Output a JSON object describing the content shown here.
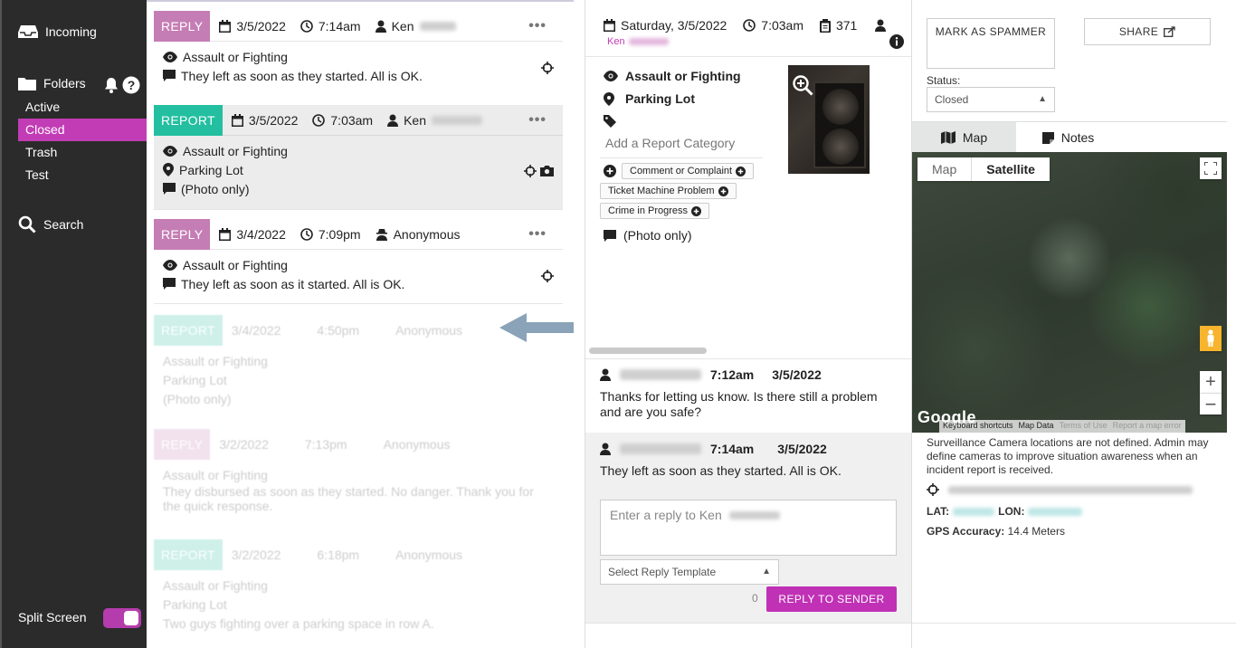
{
  "sidebar": {
    "incoming": "Incoming",
    "folders": "Folders",
    "items": [
      {
        "label": "Active"
      },
      {
        "label": "Closed"
      },
      {
        "label": "Trash"
      },
      {
        "label": "Test"
      }
    ],
    "search": "Search",
    "split_screen": "Split Screen"
  },
  "list": {
    "cards": [
      {
        "type": "REPLY",
        "date": "3/5/2022",
        "time": "7:14am",
        "sender": "Ken",
        "category": "Assault or Fighting",
        "message": "They left as soon as they started. All is OK."
      },
      {
        "type": "REPORT",
        "date": "3/5/2022",
        "time": "7:03am",
        "sender": "Ken",
        "category": "Assault or Fighting",
        "location": "Parking Lot",
        "message": "(Photo only)"
      },
      {
        "type": "REPLY",
        "date": "3/4/2022",
        "time": "7:09pm",
        "sender": "Anonymous",
        "category": "Assault or Fighting",
        "message": "They left as soon as it started. All is OK."
      },
      {
        "type": "REPORT",
        "date": "3/4/2022",
        "time": "4:50pm",
        "sender": "Anonymous",
        "category": "Assault or Fighting",
        "location": "Parking Lot",
        "message": "(Photo only)"
      },
      {
        "type": "REPLY",
        "date": "3/2/2022",
        "time": "7:13pm",
        "sender": "Anonymous",
        "category": "Assault or Fighting",
        "message": "They disbursed as soon as they started. No danger. Thank you for the quick response."
      },
      {
        "type": "REPORT",
        "date": "3/2/2022",
        "time": "6:18pm",
        "sender": "Anonymous",
        "category": "Assault or Fighting",
        "location": "Parking Lot",
        "message": "Two guys fighting over a parking space in row A."
      }
    ]
  },
  "detail": {
    "date": "Saturday, 3/5/2022",
    "time": "7:03am",
    "count": "371",
    "sender": "Ken",
    "category": "Assault or Fighting",
    "location": "Parking Lot",
    "add_category": "Add a Report Category",
    "pills": [
      "Comment or Complaint",
      "Ticket Machine Problem",
      "Crime in Progress"
    ],
    "photo_only": "(Photo only)",
    "messages": [
      {
        "time": "7:12am",
        "date": "3/5/2022",
        "text": "Thanks for letting us know. Is there still a problem and are you safe?"
      },
      {
        "time": "7:14am",
        "date": "3/5/2022",
        "text": "They left as soon as they started. All is OK."
      }
    ],
    "reply_placeholder": "Enter a reply to Ken",
    "template_select": "Select Reply Template",
    "char_count": "0",
    "reply_button": "REPLY TO SENDER"
  },
  "panel": {
    "mark_spammer": "MARK AS SPAMMER",
    "share": "SHARE",
    "status_label": "Status:",
    "status_value": "Closed",
    "tab_map": "Map",
    "tab_notes": "Notes",
    "map_type_map": "Map",
    "map_type_satellite": "Satellite",
    "google": "Google",
    "foot": [
      "Keyboard shortcuts",
      "Map Data",
      "Terms of Use",
      "Report a map error"
    ],
    "camera_note": "Surveillance Camera locations are not defined. Admin may define cameras to improve situation awareness when an incident report is received.",
    "lat_label": "LAT:",
    "lon_label": "LON:",
    "gps_label": "GPS Accuracy:",
    "gps_value": "14.4 Meters"
  }
}
